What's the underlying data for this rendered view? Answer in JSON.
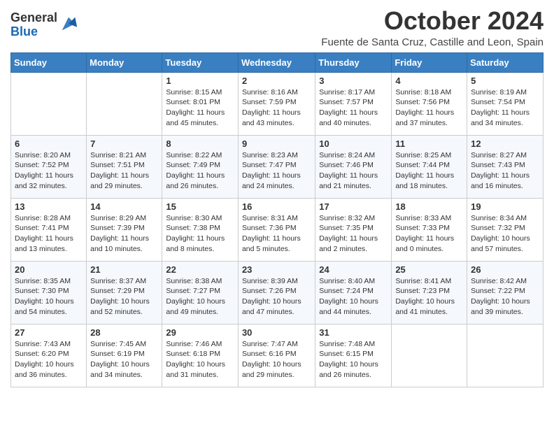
{
  "header": {
    "logo_general": "General",
    "logo_blue": "Blue",
    "month_title": "October 2024",
    "location": "Fuente de Santa Cruz, Castille and Leon, Spain"
  },
  "weekdays": [
    "Sunday",
    "Monday",
    "Tuesday",
    "Wednesday",
    "Thursday",
    "Friday",
    "Saturday"
  ],
  "weeks": [
    [
      {
        "day": "",
        "info": ""
      },
      {
        "day": "",
        "info": ""
      },
      {
        "day": "1",
        "info": "Sunrise: 8:15 AM\nSunset: 8:01 PM\nDaylight: 11 hours and 45 minutes."
      },
      {
        "day": "2",
        "info": "Sunrise: 8:16 AM\nSunset: 7:59 PM\nDaylight: 11 hours and 43 minutes."
      },
      {
        "day": "3",
        "info": "Sunrise: 8:17 AM\nSunset: 7:57 PM\nDaylight: 11 hours and 40 minutes."
      },
      {
        "day": "4",
        "info": "Sunrise: 8:18 AM\nSunset: 7:56 PM\nDaylight: 11 hours and 37 minutes."
      },
      {
        "day": "5",
        "info": "Sunrise: 8:19 AM\nSunset: 7:54 PM\nDaylight: 11 hours and 34 minutes."
      }
    ],
    [
      {
        "day": "6",
        "info": "Sunrise: 8:20 AM\nSunset: 7:52 PM\nDaylight: 11 hours and 32 minutes."
      },
      {
        "day": "7",
        "info": "Sunrise: 8:21 AM\nSunset: 7:51 PM\nDaylight: 11 hours and 29 minutes."
      },
      {
        "day": "8",
        "info": "Sunrise: 8:22 AM\nSunset: 7:49 PM\nDaylight: 11 hours and 26 minutes."
      },
      {
        "day": "9",
        "info": "Sunrise: 8:23 AM\nSunset: 7:47 PM\nDaylight: 11 hours and 24 minutes."
      },
      {
        "day": "10",
        "info": "Sunrise: 8:24 AM\nSunset: 7:46 PM\nDaylight: 11 hours and 21 minutes."
      },
      {
        "day": "11",
        "info": "Sunrise: 8:25 AM\nSunset: 7:44 PM\nDaylight: 11 hours and 18 minutes."
      },
      {
        "day": "12",
        "info": "Sunrise: 8:27 AM\nSunset: 7:43 PM\nDaylight: 11 hours and 16 minutes."
      }
    ],
    [
      {
        "day": "13",
        "info": "Sunrise: 8:28 AM\nSunset: 7:41 PM\nDaylight: 11 hours and 13 minutes."
      },
      {
        "day": "14",
        "info": "Sunrise: 8:29 AM\nSunset: 7:39 PM\nDaylight: 11 hours and 10 minutes."
      },
      {
        "day": "15",
        "info": "Sunrise: 8:30 AM\nSunset: 7:38 PM\nDaylight: 11 hours and 8 minutes."
      },
      {
        "day": "16",
        "info": "Sunrise: 8:31 AM\nSunset: 7:36 PM\nDaylight: 11 hours and 5 minutes."
      },
      {
        "day": "17",
        "info": "Sunrise: 8:32 AM\nSunset: 7:35 PM\nDaylight: 11 hours and 2 minutes."
      },
      {
        "day": "18",
        "info": "Sunrise: 8:33 AM\nSunset: 7:33 PM\nDaylight: 11 hours and 0 minutes."
      },
      {
        "day": "19",
        "info": "Sunrise: 8:34 AM\nSunset: 7:32 PM\nDaylight: 10 hours and 57 minutes."
      }
    ],
    [
      {
        "day": "20",
        "info": "Sunrise: 8:35 AM\nSunset: 7:30 PM\nDaylight: 10 hours and 54 minutes."
      },
      {
        "day": "21",
        "info": "Sunrise: 8:37 AM\nSunset: 7:29 PM\nDaylight: 10 hours and 52 minutes."
      },
      {
        "day": "22",
        "info": "Sunrise: 8:38 AM\nSunset: 7:27 PM\nDaylight: 10 hours and 49 minutes."
      },
      {
        "day": "23",
        "info": "Sunrise: 8:39 AM\nSunset: 7:26 PM\nDaylight: 10 hours and 47 minutes."
      },
      {
        "day": "24",
        "info": "Sunrise: 8:40 AM\nSunset: 7:24 PM\nDaylight: 10 hours and 44 minutes."
      },
      {
        "day": "25",
        "info": "Sunrise: 8:41 AM\nSunset: 7:23 PM\nDaylight: 10 hours and 41 minutes."
      },
      {
        "day": "26",
        "info": "Sunrise: 8:42 AM\nSunset: 7:22 PM\nDaylight: 10 hours and 39 minutes."
      }
    ],
    [
      {
        "day": "27",
        "info": "Sunrise: 7:43 AM\nSunset: 6:20 PM\nDaylight: 10 hours and 36 minutes."
      },
      {
        "day": "28",
        "info": "Sunrise: 7:45 AM\nSunset: 6:19 PM\nDaylight: 10 hours and 34 minutes."
      },
      {
        "day": "29",
        "info": "Sunrise: 7:46 AM\nSunset: 6:18 PM\nDaylight: 10 hours and 31 minutes."
      },
      {
        "day": "30",
        "info": "Sunrise: 7:47 AM\nSunset: 6:16 PM\nDaylight: 10 hours and 29 minutes."
      },
      {
        "day": "31",
        "info": "Sunrise: 7:48 AM\nSunset: 6:15 PM\nDaylight: 10 hours and 26 minutes."
      },
      {
        "day": "",
        "info": ""
      },
      {
        "day": "",
        "info": ""
      }
    ]
  ]
}
